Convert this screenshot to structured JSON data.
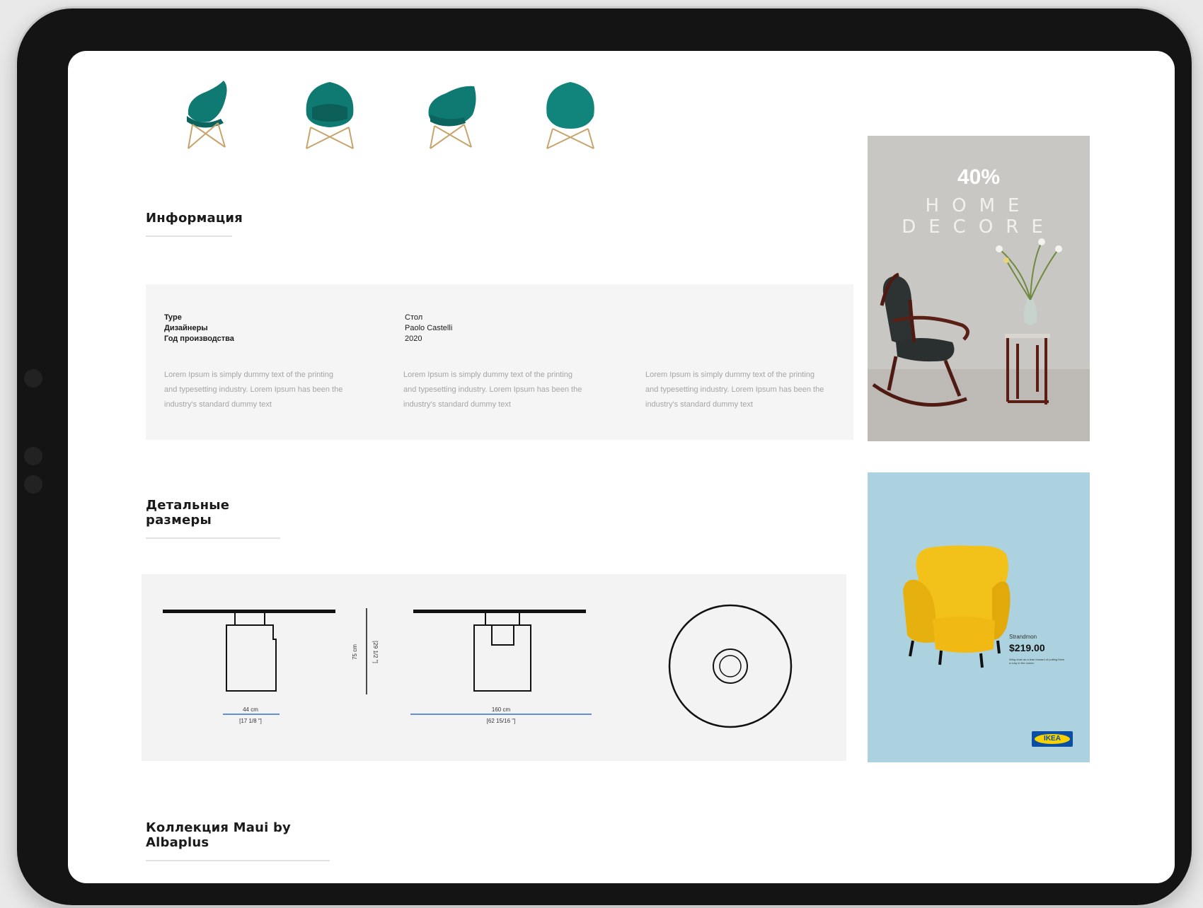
{
  "thumbnails": [
    {
      "icon": "chair-icon",
      "label": ""
    },
    {
      "icon": "chair-icon",
      "label": ""
    },
    {
      "icon": "chair-icon",
      "label": ""
    },
    {
      "icon": "chair-icon",
      "label": ""
    }
  ],
  "sections": {
    "info_title": "Информация",
    "dims_title": "Детальные размеры",
    "collection_title": "Коллекция Maui by Albaplus"
  },
  "info": {
    "keys": [
      "Type",
      "Дизайнеры",
      "Год производства"
    ],
    "values": [
      "Стол",
      "Paolo Castelli",
      "2020"
    ],
    "paragraphs": [
      "Lorem Ipsum is simply dummy text of the printing and typesetting industry. Lorem Ipsum has been the industry's standard dummy text",
      "Lorem Ipsum is simply dummy text of the printing and typesetting industry. Lorem Ipsum has been the industry's standard dummy text",
      "Lorem Ipsum is simply dummy text of the printing and typesetting industry. Lorem Ipsum has been the industry's standard dummy text"
    ]
  },
  "dimensions": {
    "width_small": "44 cm",
    "width_small_in": "[17 1/8 \"]",
    "height": "75 cm",
    "height_in": "[29 1/2 \"]",
    "width_large": "160 cm",
    "width_large_in": "[62 15/16 \"]"
  },
  "ads": {
    "home": {
      "percent": "40%",
      "line1": "HOME",
      "line2": "DECORE"
    },
    "ikea": {
      "product": "Strandmon",
      "price": "$219.00",
      "desc": "Wing chair as a lean forward of putting them a cosy in the corner.",
      "brand": "IKEA",
      "colors": {
        "background": "#acd2df",
        "chair": "#f3c21a"
      }
    }
  },
  "colors": {
    "chair_teal": "#0e7a72",
    "accent_blue": "#2f6fd0"
  }
}
